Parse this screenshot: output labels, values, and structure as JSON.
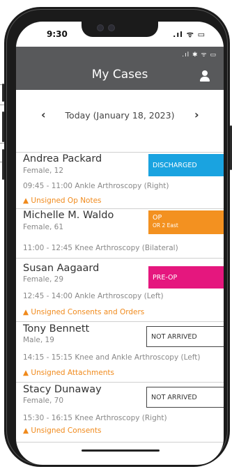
{
  "system": {
    "time": "9:30",
    "icons": ".ıl ᯤ ▭"
  },
  "app": {
    "status_icons": ".ıl ✱ ᯤ ▭",
    "title": "My Cases",
    "user_icon": "person-icon"
  },
  "date_nav": {
    "prev": "‹",
    "label": "Today (January 18, 2023)",
    "next": "›"
  },
  "colors": {
    "appbar": "#58595b",
    "discharged": "#1aa3e0",
    "op": "#f39120",
    "preop": "#e5177e",
    "warning": "#f08a1c"
  },
  "cases": [
    {
      "name": "Andrea Packard",
      "demo": "Female, 12",
      "procedure": "09:45 - 11:00 Ankle Arthroscopy (Right)",
      "warning": "Unsigned Op Notes",
      "status": "DISCHARGED",
      "status_sub": ""
    },
    {
      "name": "Michelle M. Waldo",
      "demo": "Female, 61",
      "procedure": "11:00 - 12:45 Knee Arthroscopy (Bilateral)",
      "warning": "",
      "status": "OP",
      "status_sub": "OR 2 East"
    },
    {
      "name": "Susan Aagaard",
      "demo": "Female, 29",
      "procedure": "12:45 - 14:00 Ankle Arthroscopy (Left)",
      "warning": "Unsigned Consents and Orders",
      "status": "PRE-OP",
      "status_sub": ""
    },
    {
      "name": "Tony Bennett",
      "demo": "Male, 19",
      "procedure": "14:15 - 15:15 Knee and Ankle Arthroscopy (Left)",
      "warning": "Unsigned Attachments",
      "status": "NOT ARRIVED",
      "status_sub": ""
    },
    {
      "name": "Stacy Dunaway",
      "demo": "Female, 70",
      "procedure": "15:30 - 16:15 Knee Arthroscopy (Right)",
      "warning": "Unsigned Consents",
      "status": "NOT ARRIVED",
      "status_sub": ""
    }
  ]
}
